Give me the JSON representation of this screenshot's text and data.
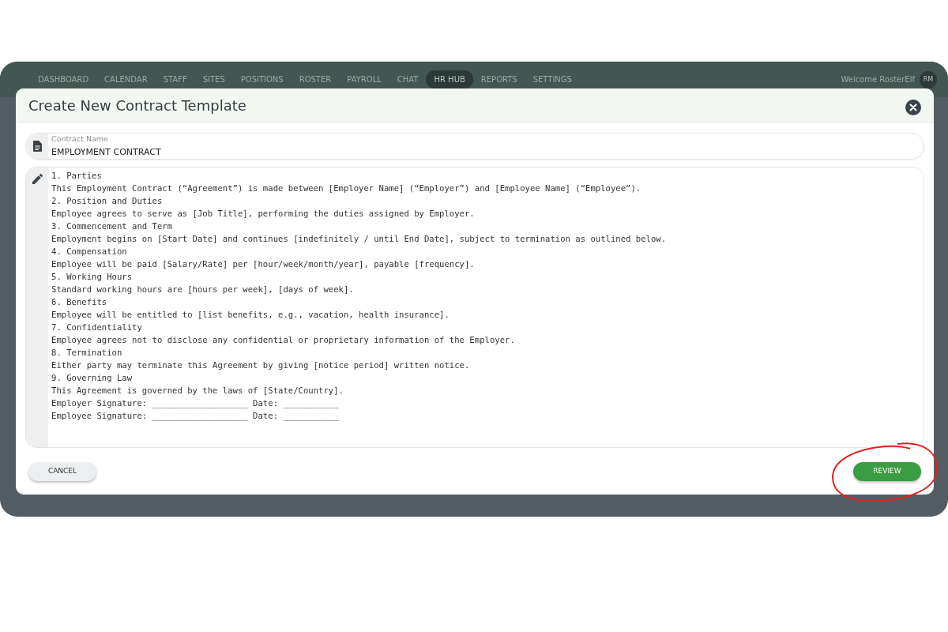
{
  "nav": {
    "items": [
      {
        "label": "DASHBOARD",
        "selected": false
      },
      {
        "label": "CALENDAR",
        "selected": false
      },
      {
        "label": "STAFF",
        "selected": false
      },
      {
        "label": "SITES",
        "selected": false
      },
      {
        "label": "POSITIONS",
        "selected": false
      },
      {
        "label": "ROSTER",
        "selected": false
      },
      {
        "label": "PAYROLL",
        "selected": false
      },
      {
        "label": "CHAT",
        "selected": false
      },
      {
        "label": "HR HUB",
        "selected": true
      },
      {
        "label": "REPORTS",
        "selected": false
      },
      {
        "label": "SETTINGS",
        "selected": false
      }
    ],
    "welcome": "Welcome RosterElf",
    "avatar": "RM"
  },
  "modal": {
    "title": "Create New Contract Template",
    "contract_name": {
      "label": "Contract Name",
      "value": "EMPLOYMENT CONTRACT"
    },
    "body_lines": [
      "1. Parties",
      "This Employment Contract (“Agreement”) is made between [Employer Name] (“Employer”) and [Employee Name] (“Employee”).",
      "2. Position and Duties",
      "Employee agrees to serve as [Job Title], performing the duties assigned by Employer.",
      "3. Commencement and Term",
      "Employment begins on [Start Date] and continues [indefinitely / until End Date], subject to termination as outlined below.",
      "4. Compensation",
      "Employee will be paid [Salary/Rate] per [hour/week/month/year], payable [frequency].",
      "5. Working Hours",
      "Standard working hours are [hours per week], [days of week].",
      "6. Benefits",
      "Employee will be entitled to [list benefits, e.g., vacation, health insurance].",
      "7. Confidentiality",
      "Employee agrees not to disclose any confidential or proprietary information of the Employer.",
      "8. Termination",
      "Either party may terminate this Agreement by giving [notice period] written notice.",
      "9. Governing Law",
      "This Agreement is governed by the laws of [State/Country].",
      "Employer Signature: ___________________ Date: ___________",
      "Employee Signature: ___________________ Date: ___________"
    ],
    "cancel": "CANCEL",
    "review": "REVIEW"
  }
}
